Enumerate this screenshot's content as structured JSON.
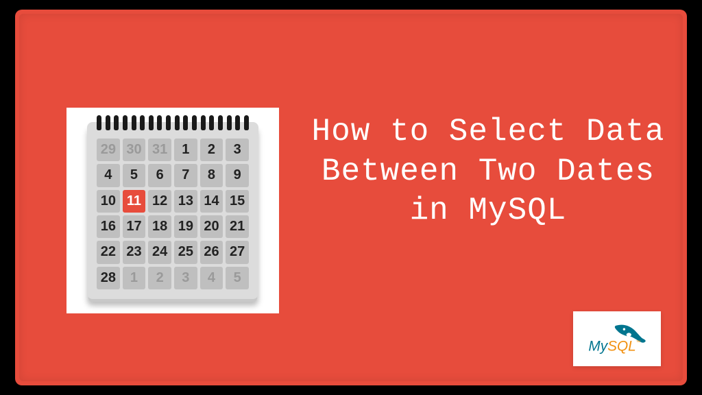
{
  "title": "How to Select Data Between Two Dates in MySQL",
  "calendar": {
    "cells": [
      {
        "n": "29",
        "dim": true
      },
      {
        "n": "30",
        "dim": true
      },
      {
        "n": "31",
        "dim": true
      },
      {
        "n": "1"
      },
      {
        "n": "2"
      },
      {
        "n": "3"
      },
      {
        "n": "4"
      },
      {
        "n": "5"
      },
      {
        "n": "6"
      },
      {
        "n": "7"
      },
      {
        "n": "8"
      },
      {
        "n": "9"
      },
      {
        "n": "10"
      },
      {
        "n": "11",
        "hl": true
      },
      {
        "n": "12"
      },
      {
        "n": "13"
      },
      {
        "n": "14"
      },
      {
        "n": "15"
      },
      {
        "n": "16"
      },
      {
        "n": "17"
      },
      {
        "n": "18"
      },
      {
        "n": "19"
      },
      {
        "n": "20"
      },
      {
        "n": "21"
      },
      {
        "n": "22"
      },
      {
        "n": "23"
      },
      {
        "n": "24"
      },
      {
        "n": "25"
      },
      {
        "n": "26"
      },
      {
        "n": "27"
      },
      {
        "n": "28"
      },
      {
        "n": "1",
        "dim": true
      },
      {
        "n": "2",
        "dim": true
      },
      {
        "n": "3",
        "dim": true
      },
      {
        "n": "4",
        "dim": true
      },
      {
        "n": "5",
        "dim": true
      }
    ],
    "rings": 18
  },
  "logo": {
    "text_primary": "My",
    "text_secondary": "SQL",
    "tm": "™",
    "color_primary": "#00758F",
    "color_secondary": "#F29111"
  },
  "colors": {
    "background": "#000000",
    "slide": "#e74c3c",
    "calendar_body": "#dcdcdc",
    "cell": "#bfbfbf",
    "highlight": "#e74c3c"
  }
}
